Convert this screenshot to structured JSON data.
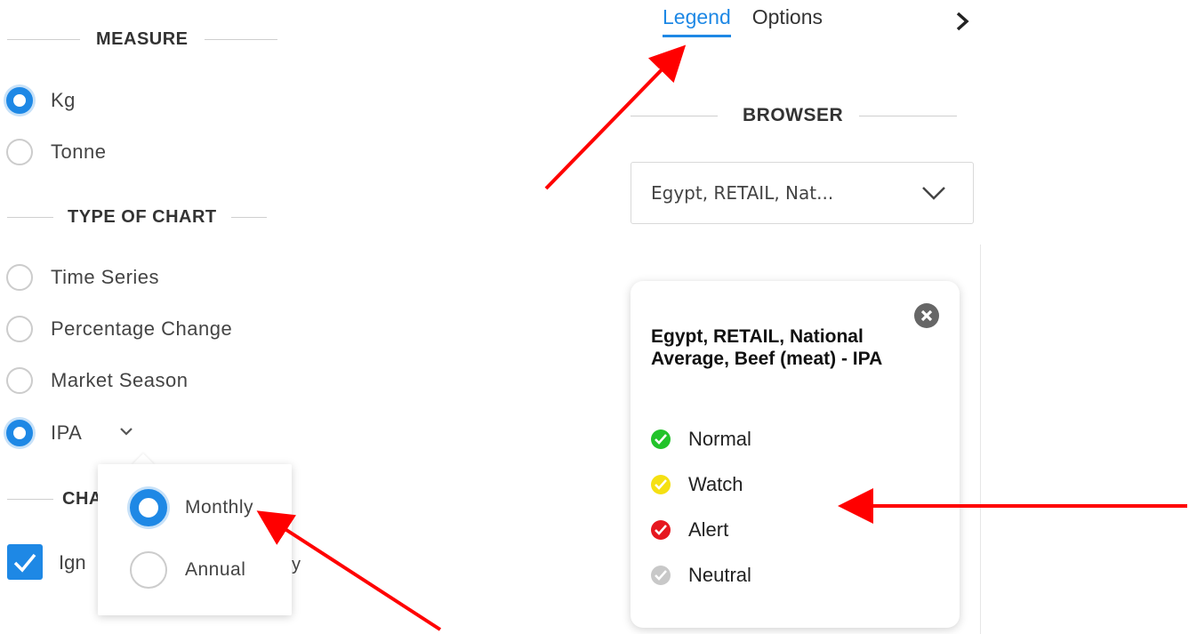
{
  "measure": {
    "title": "MEASURE",
    "options": [
      {
        "label": "Kg",
        "selected": true
      },
      {
        "label": "Tonne",
        "selected": false
      }
    ]
  },
  "chart_type": {
    "title": "TYPE OF CHART",
    "options": [
      {
        "label": "Time Series",
        "selected": false
      },
      {
        "label": "Percentage Change",
        "selected": false
      },
      {
        "label": "Market Season",
        "selected": false
      },
      {
        "label": "IPA",
        "selected": true
      }
    ]
  },
  "ipa_popup": {
    "options": [
      {
        "label": "Monthly",
        "selected": true
      },
      {
        "label": "Annual",
        "selected": false
      }
    ]
  },
  "partial": {
    "section_fragment": "CHA",
    "checkbox_fragment": "Ign",
    "checkbox_tail": "y"
  },
  "tabs": [
    {
      "label": "Legend",
      "active": true
    },
    {
      "label": "Options",
      "active": false
    }
  ],
  "browser": {
    "title": "BROWSER",
    "selected_value": "Egypt, RETAIL, Nat..."
  },
  "legend": {
    "title": "Egypt, RETAIL, National Average, Beef (meat) - IPA",
    "items": [
      {
        "label": "Normal",
        "color": "#22c32a"
      },
      {
        "label": "Watch",
        "color": "#f5e012"
      },
      {
        "label": "Alert",
        "color": "#e6171f"
      },
      {
        "label": "Neutral",
        "color": "#c8c8c8"
      }
    ]
  },
  "colors": {
    "accent": "#1e88e5",
    "annotation_arrow": "#ff0000"
  }
}
